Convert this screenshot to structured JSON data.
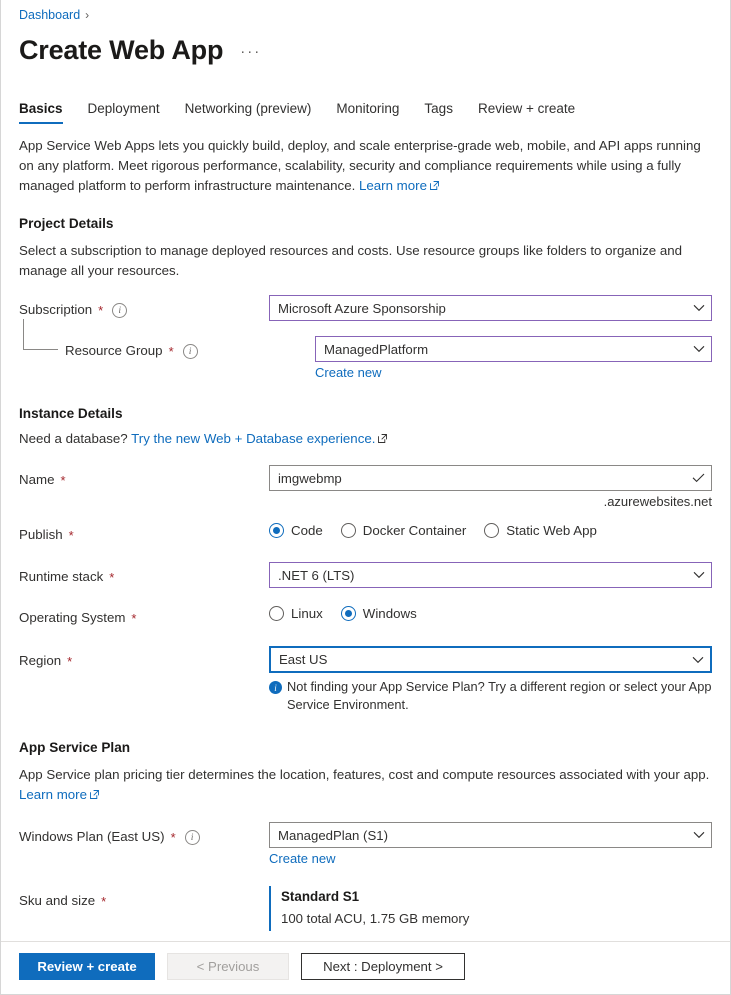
{
  "breadcrumb": {
    "items": [
      "Dashboard"
    ],
    "separator": "›"
  },
  "header": {
    "title": "Create Web App",
    "more_menu": "···"
  },
  "tabs": [
    {
      "label": "Basics",
      "active": true
    },
    {
      "label": "Deployment",
      "active": false
    },
    {
      "label": "Networking (preview)",
      "active": false
    },
    {
      "label": "Monitoring",
      "active": false
    },
    {
      "label": "Tags",
      "active": false
    },
    {
      "label": "Review + create",
      "active": false
    }
  ],
  "intro": {
    "text": "App Service Web Apps lets you quickly build, deploy, and scale enterprise-grade web, mobile, and API apps running on any platform. Meet rigorous performance, scalability, security and compliance requirements while using a fully managed platform to perform infrastructure maintenance.",
    "link_label": "Learn more"
  },
  "project_details": {
    "heading": "Project Details",
    "description": "Select a subscription to manage deployed resources and costs. Use resource groups like folders to organize and manage all your resources.",
    "subscription": {
      "label": "Subscription",
      "required": "*",
      "value": "Microsoft Azure Sponsorship"
    },
    "resource_group": {
      "label": "Resource Group",
      "required": "*",
      "value": "ManagedPlatform",
      "create_new": "Create new"
    }
  },
  "instance_details": {
    "heading": "Instance Details",
    "database_prompt": "Need a database?",
    "database_link": "Try the new Web + Database experience.",
    "name": {
      "label": "Name",
      "required": "*",
      "value": "imgwebmp",
      "suffix": ".azurewebsites.net"
    },
    "publish": {
      "label": "Publish",
      "required": "*",
      "options": [
        {
          "label": "Code",
          "checked": true
        },
        {
          "label": "Docker Container",
          "checked": false
        },
        {
          "label": "Static Web App",
          "checked": false
        }
      ]
    },
    "runtime_stack": {
      "label": "Runtime stack",
      "required": "*",
      "value": ".NET 6 (LTS)"
    },
    "operating_system": {
      "label": "Operating System",
      "required": "*",
      "options": [
        {
          "label": "Linux",
          "checked": false
        },
        {
          "label": "Windows",
          "checked": true
        }
      ]
    },
    "region": {
      "label": "Region",
      "required": "*",
      "value": "East US",
      "note": "Not finding your App Service Plan? Try a different region or select your App Service Environment."
    }
  },
  "app_service_plan": {
    "heading": "App Service Plan",
    "description": "App Service plan pricing tier determines the location, features, cost and compute resources associated with your app.",
    "link_label": "Learn more",
    "windows_plan": {
      "label": "Windows Plan (East US)",
      "required": "*",
      "value": "ManagedPlan (S1)",
      "create_new": "Create new"
    },
    "sku_and_size": {
      "label": "Sku and size",
      "required": "*",
      "title": "Standard S1",
      "subtitle": "100 total ACU, 1.75 GB memory"
    }
  },
  "footer": {
    "review_create": "Review + create",
    "previous": "< Previous",
    "next": "Next : Deployment >"
  },
  "colors": {
    "accent_blue": "#0f6cbd",
    "required_red": "#a4262c",
    "dropdown_purple": "#8764b8",
    "dropdown_gray": "#8a8886"
  }
}
